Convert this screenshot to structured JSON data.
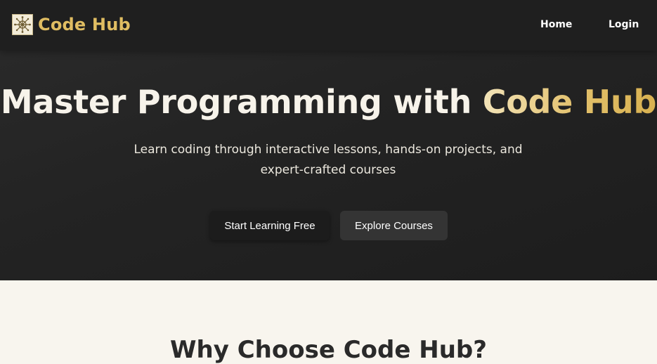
{
  "navbar": {
    "brand_name": "Code Hub",
    "logo_icon": "code-compass-logo-icon",
    "links": [
      {
        "label": "Home"
      },
      {
        "label": "Login"
      }
    ]
  },
  "hero": {
    "title_main": "Master Programming with ",
    "title_accent": "Code Hub",
    "subtitle_line1": "Learn coding through interactive lessons, hands-on projects, and",
    "subtitle_line2": "expert-crafted courses",
    "primary_button": "Start Learning Free",
    "secondary_button": "Explore Courses"
  },
  "features": {
    "title": "Why Choose Code Hub?"
  },
  "colors": {
    "brand_gold": "#e0bd62",
    "hero_background": "#232323",
    "page_background": "#f8f5ee"
  }
}
